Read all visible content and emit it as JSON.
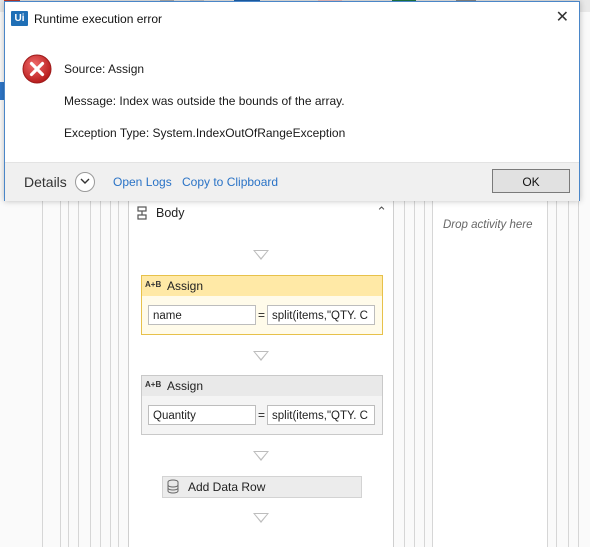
{
  "dialog": {
    "app_logo": "Ui",
    "title": "Runtime execution error",
    "close_icon": "close-icon",
    "error_icon": "error-icon",
    "source": "Source: Assign",
    "message": "Message: Index was outside the bounds of the array.",
    "exception_type": "Exception Type: System.IndexOutOfRangeException",
    "details_label": "Details",
    "open_logs": "Open Logs",
    "copy_to_clipboard": "Copy to Clipboard",
    "ok": "OK"
  },
  "designer": {
    "body_title": "Body",
    "assign1": {
      "title": "Assign",
      "icon_text": "A+B",
      "to": "name",
      "value": "split(items,\"QTY. C"
    },
    "assign2": {
      "title": "Assign",
      "icon_text": "A+B",
      "to": "Quantity",
      "value": "split(items,\"QTY. C"
    },
    "add_data_row": "Add Data Row",
    "drop_here": "Drop activity here"
  },
  "colors": {
    "accent": "#2a73c6",
    "error": "#d32f2f",
    "selection": "#e7c14a"
  }
}
